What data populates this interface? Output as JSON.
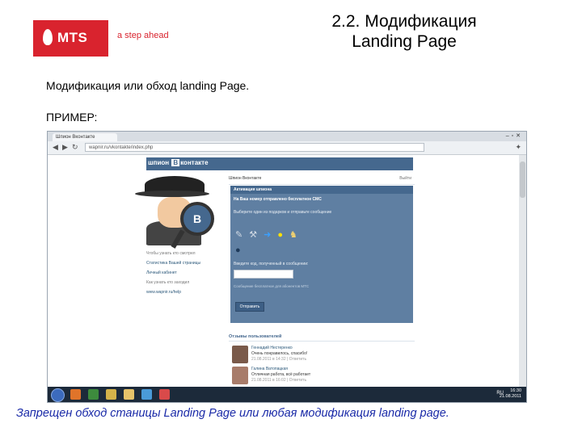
{
  "brand": {
    "logo_text": "MTS",
    "tagline": "a step ahead",
    "color": "#d9232e"
  },
  "slide": {
    "title_line1": "2.2. Модификация",
    "title_line2": "Landing Page",
    "subtitle": "Модификация или обход landing Page.",
    "example_label": "ПРИМЕР:",
    "footer_note": "Запрещен обход станицы Landing Page или любая модификация landing page."
  },
  "browser": {
    "tab_title": "Шпион Вконтакте",
    "url": "wapnir.ru/vkontakte/index.php",
    "icons": [
      "back-icon",
      "forward-icon",
      "reload-icon",
      "wrench-icon"
    ]
  },
  "vk_page": {
    "logo_prefix": "шпион",
    "logo_b": "В",
    "logo_suffix": "контакте",
    "top_left": "Шпион Вконтакте",
    "top_right": "Выйти",
    "panel_title": "Активация шпиона",
    "panel_head": "На Ваш номер отправлено бесплатное СМС",
    "panel_text": "Выберите один из подарков и отправьте сообщение",
    "panel_message_label": "Введите код, полученный в сообщении:",
    "panel_note": "Сообщение бесплатное для абонентов МТС",
    "send_label": "Отправить",
    "left_links": [
      "Чтобы узнать кто смотрел",
      "Статистика Вашей страницы",
      "Личный кабинет",
      "Как узнать кто заходил",
      "www.wapnir.ru/help"
    ],
    "recent_title": "Отзывы пользователей",
    "entries": [
      {
        "name": "Геннадий Нестеренко",
        "text": "Очень понравилось, спасибо!",
        "meta": "21.08.2011 в 14:32 | Ответить"
      },
      {
        "name": "Галина Ватопацкая",
        "text": "Отличная работа, всё работает",
        "meta": "21.08.2011 в 16:02 | Ответить"
      }
    ]
  },
  "taskbar": {
    "lang": "RU",
    "clock_time": "16:30",
    "clock_date": "21.08.2011",
    "app_colors": [
      "#e0742a",
      "#3d8b3d",
      "#d4b34a",
      "#e6c36a",
      "#4a9bd9",
      "#d94a4a"
    ]
  }
}
